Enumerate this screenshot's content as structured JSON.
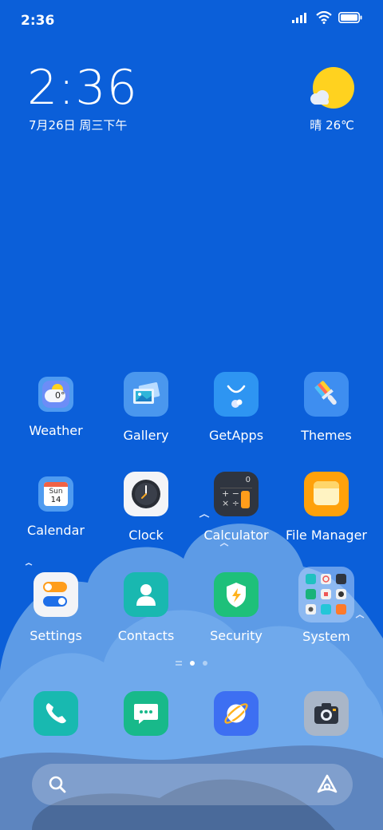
{
  "status_bar": {
    "time": "2:36",
    "icons": [
      "signal-icon",
      "wifi-icon",
      "battery-icon"
    ]
  },
  "clock_widget": {
    "time": "2:36",
    "date": "7月26日 周三下午"
  },
  "weather_widget": {
    "condition_temp": "晴 26℃",
    "icon": "sunny-cloud-icon"
  },
  "apps": {
    "row1": [
      {
        "label": "Weather",
        "icon": "weather-icon",
        "mini_temp": "0°"
      },
      {
        "label": "Gallery",
        "icon": "gallery-icon"
      },
      {
        "label": "GetApps",
        "icon": "getapps-icon"
      },
      {
        "label": "Themes",
        "icon": "themes-icon"
      }
    ],
    "row2": [
      {
        "label": "Calendar",
        "icon": "calendar-icon",
        "day_name": "Sun",
        "day_num": "14"
      },
      {
        "label": "Clock",
        "icon": "clock-icon"
      },
      {
        "label": "Calculator",
        "icon": "calculator-icon",
        "display": "0"
      },
      {
        "label": "File Manager",
        "icon": "file-manager-icon"
      }
    ],
    "row3": [
      {
        "label": "Settings",
        "icon": "settings-icon"
      },
      {
        "label": "Contacts",
        "icon": "contacts-icon"
      },
      {
        "label": "Security",
        "icon": "security-icon"
      },
      {
        "label": "System",
        "icon": "system-folder-icon"
      }
    ]
  },
  "page_indicator": {
    "pages": 2,
    "active": 1
  },
  "dock": [
    "phone-icon",
    "messages-icon",
    "browser-icon",
    "camera-icon"
  ],
  "search_bar": {
    "left_icon": "search-icon",
    "right_icon": "assistant-icon"
  },
  "colors": {
    "background": "#0b5fd9",
    "sun": "#ffd21f",
    "cloud_light": "#6ea8ea",
    "hill": "#4a6a9a"
  }
}
